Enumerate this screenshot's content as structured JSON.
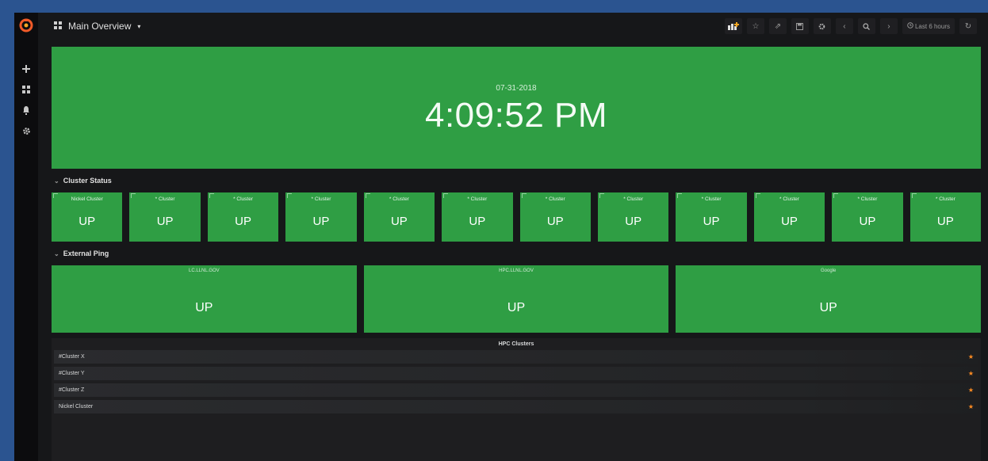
{
  "header": {
    "title": "Main Overview"
  },
  "toolbar": {
    "time_range": "Last 6 hours",
    "zoom_out_label": "Q"
  },
  "clock": {
    "date": "07-31-2018",
    "time": "4:09:52 PM"
  },
  "rows": {
    "cluster_status": "Cluster Status",
    "external_ping": "External Ping"
  },
  "clusters": [
    {
      "title": "Nickel Cluster",
      "value": "UP"
    },
    {
      "title": "* Cluster",
      "value": "UP"
    },
    {
      "title": "* Cluster",
      "value": "UP"
    },
    {
      "title": "* Cluster",
      "value": "UP"
    },
    {
      "title": "* Cluster",
      "value": "UP"
    },
    {
      "title": "* Cluster",
      "value": "UP"
    },
    {
      "title": "* Cluster",
      "value": "UP"
    },
    {
      "title": "* Cluster",
      "value": "UP"
    },
    {
      "title": "* Cluster",
      "value": "UP"
    },
    {
      "title": "* Cluster",
      "value": "UP"
    },
    {
      "title": "* Cluster",
      "value": "UP"
    },
    {
      "title": "* Cluster",
      "value": "UP"
    }
  ],
  "ping": [
    {
      "title": "LC.LLNL.GOV",
      "value": "UP"
    },
    {
      "title": "HPC.LLNL.GOV",
      "value": "UP"
    },
    {
      "title": "Google",
      "value": "UP"
    }
  ],
  "hpc_panel": {
    "title": "HPC Clusters",
    "items": [
      {
        "label": "#Cluster X"
      },
      {
        "label": "#Cluster Y"
      },
      {
        "label": "#Cluster Z"
      },
      {
        "label": "Nickel Cluster"
      }
    ]
  },
  "colors": {
    "up_green": "#2f9e44",
    "star": "#ff8c22",
    "logo": "#f05a28",
    "frame": "#2b5490"
  }
}
